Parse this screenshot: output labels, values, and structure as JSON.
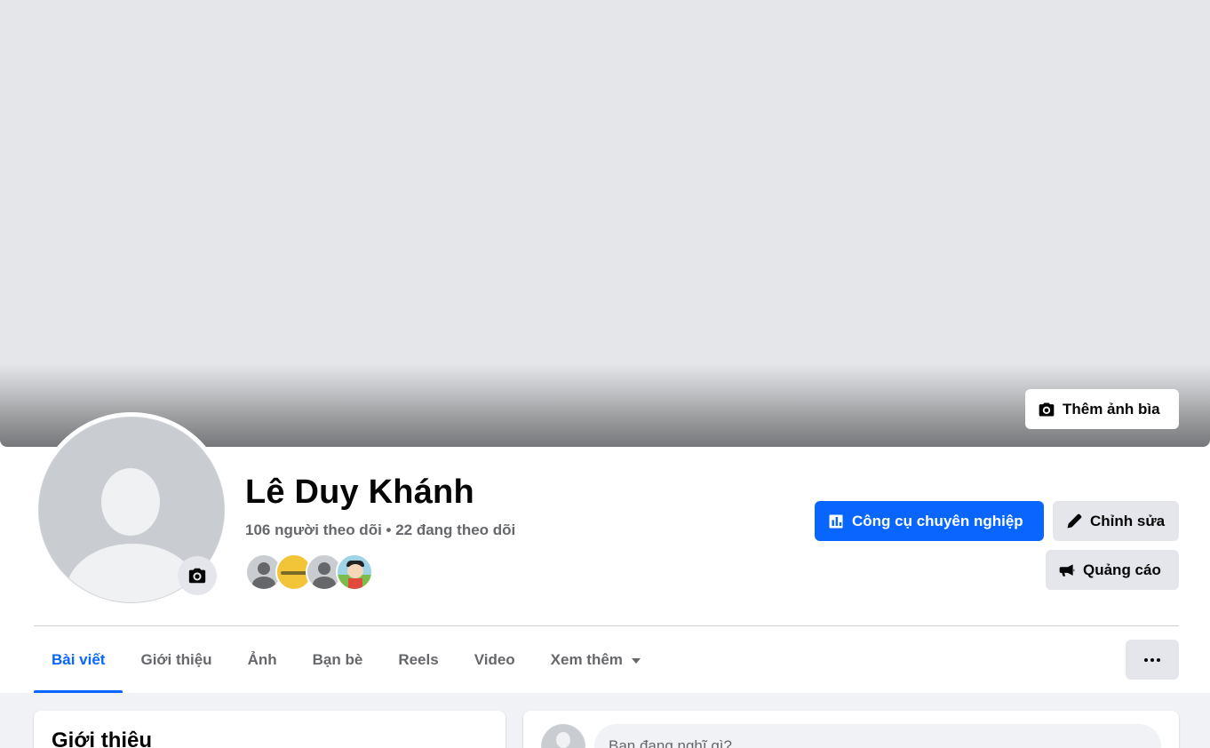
{
  "profile": {
    "name": "Lê Duy Khánh",
    "followers_text": "106 người theo dõi",
    "separator": " • ",
    "following_text": "22 đang theo dõi"
  },
  "cover": {
    "add_cover_label": "Thêm ảnh bìa"
  },
  "actions": {
    "pro_tools_label": "Công cụ chuyên nghiệp",
    "edit_label": "Chỉnh sửa",
    "ads_label": "Quảng cáo"
  },
  "tabs": [
    {
      "label": "Bài viết",
      "active": true
    },
    {
      "label": "Giới thiệu",
      "active": false
    },
    {
      "label": "Ảnh",
      "active": false
    },
    {
      "label": "Bạn bè",
      "active": false
    },
    {
      "label": "Reels",
      "active": false
    },
    {
      "label": "Video",
      "active": false
    },
    {
      "label": "Xem thêm",
      "active": false
    }
  ],
  "intro": {
    "title": "Giới thiệu"
  },
  "composer": {
    "placeholder": "Bạn đang nghĩ gì?"
  },
  "colors": {
    "accent": "#0866ff",
    "secondary_button": "#e4e6eb",
    "page_bg": "#f0f2f5"
  },
  "icons": {
    "cover_button": "camera-icon",
    "avatar_button": "camera-icon",
    "pro_tools": "bar-chart-icon",
    "edit": "pencil-icon",
    "ads": "megaphone-icon",
    "more": "ellipsis-icon",
    "see_more": "caret-down-icon"
  }
}
